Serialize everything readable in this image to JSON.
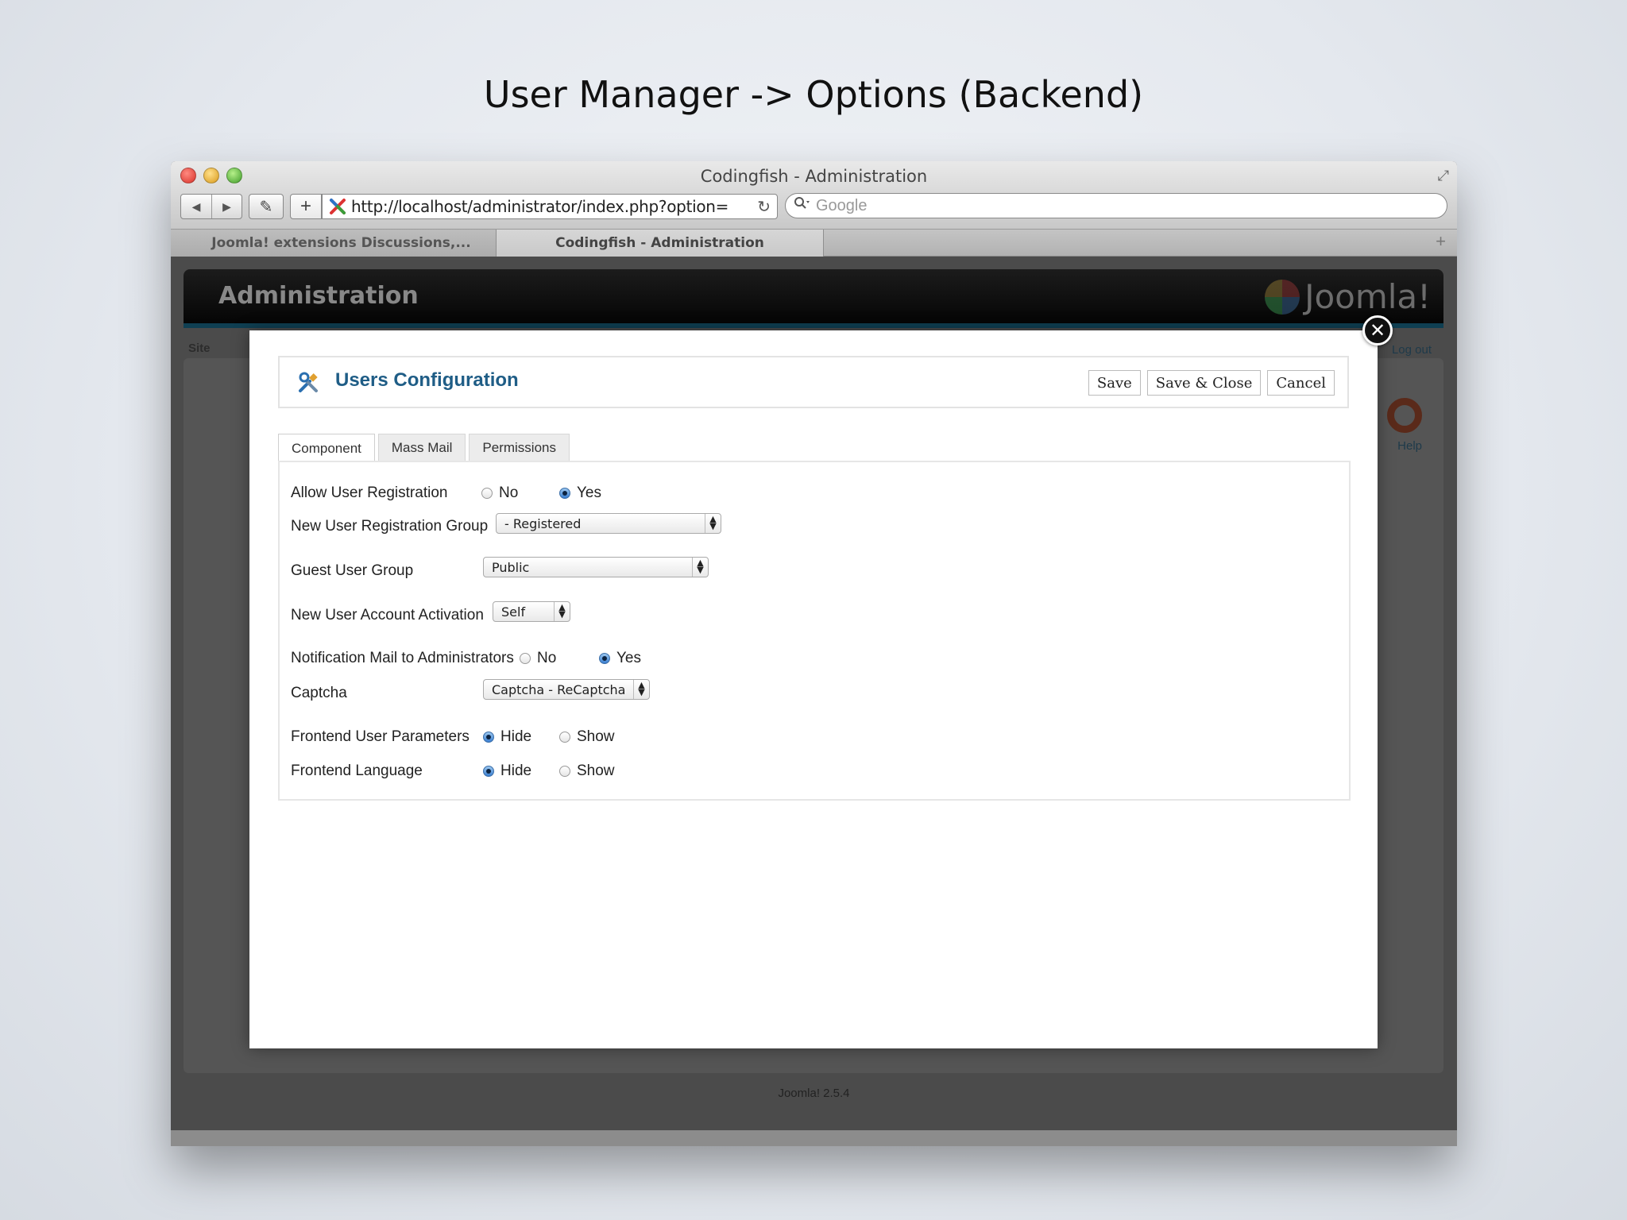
{
  "slide": {
    "title": "User Manager -> Options (Backend)"
  },
  "browser": {
    "window_title": "Codingfish - Administration",
    "url": "http://localhost/administrator/index.php?option=",
    "search_placeholder": "Google",
    "tabs": [
      {
        "label": "Joomla! extensions Discussions,..."
      },
      {
        "label": "Codingfish - Administration"
      }
    ]
  },
  "admin": {
    "title": "Administration",
    "logo_text": "Joomla!",
    "sub_label": "Site",
    "logout": "Log out",
    "help": "Help",
    "footer": "Joomla! 2.5.4"
  },
  "modal": {
    "title": "Users Configuration",
    "buttons": {
      "save": "Save",
      "save_close": "Save & Close",
      "cancel": "Cancel"
    },
    "tabs": [
      {
        "label": "Component",
        "active": true
      },
      {
        "label": "Mass Mail",
        "active": false
      },
      {
        "label": "Permissions",
        "active": false
      }
    ],
    "fields": {
      "allow_registration": {
        "label": "Allow User Registration",
        "options": [
          "No",
          "Yes"
        ],
        "selected": "Yes"
      },
      "registration_group": {
        "label": "New User Registration Group",
        "value": "- Registered"
      },
      "guest_group": {
        "label": "Guest User Group",
        "value": "Public"
      },
      "account_activation": {
        "label": "New User Account Activation",
        "value": "Self"
      },
      "notification_mail": {
        "label": "Notification Mail to Administrators",
        "options": [
          "No",
          "Yes"
        ],
        "selected": "Yes"
      },
      "captcha": {
        "label": "Captcha",
        "value": "Captcha - ReCaptcha"
      },
      "frontend_params": {
        "label": "Frontend User Parameters",
        "options": [
          "Hide",
          "Show"
        ],
        "selected": "Hide"
      },
      "frontend_language": {
        "label": "Frontend Language",
        "options": [
          "Hide",
          "Show"
        ],
        "selected": "Hide"
      }
    }
  },
  "colors": {
    "title_blue": "#1f5d86",
    "radio_selected": "#3a7ed0"
  }
}
